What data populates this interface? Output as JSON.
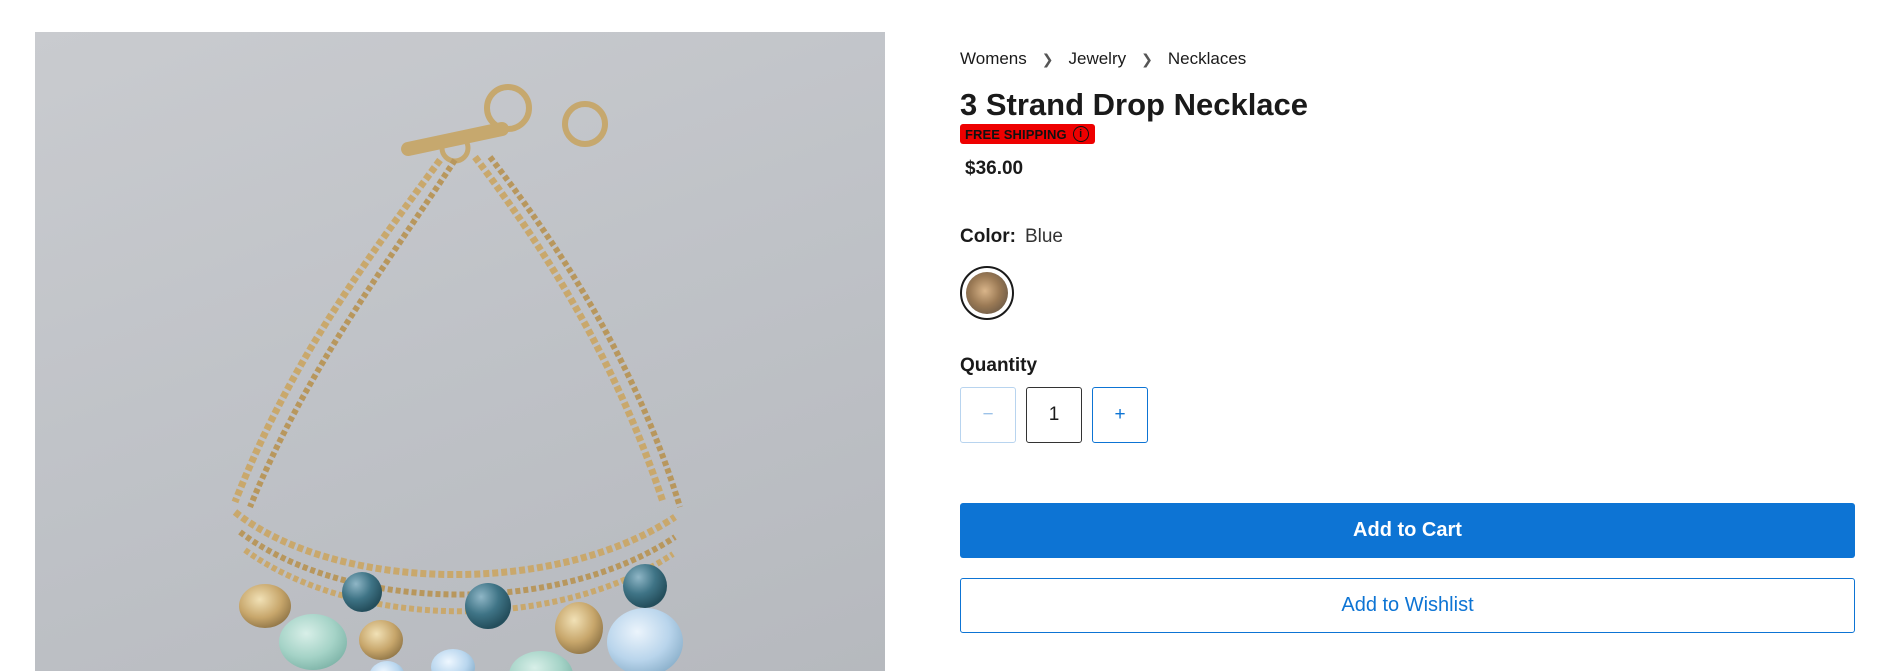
{
  "product_image": {
    "alt": "3 Strand Drop Necklace"
  },
  "breadcrumb": [
    "Womens",
    "Jewelry",
    "Necklaces"
  ],
  "product": {
    "title": "3 Strand Drop Necklace",
    "badge_label": "FREE SHIPPING",
    "badge_icon": "i",
    "price": "$36.00"
  },
  "color": {
    "label": "Color:",
    "selected": "Blue"
  },
  "quantity": {
    "label": "Quantity",
    "minus_symbol": "−",
    "plus_symbol": "+",
    "value": "1"
  },
  "actions": {
    "add_to_cart": "Add to Cart",
    "add_to_wishlist": "Add to Wishlist"
  },
  "colors": {
    "primary": "#0d74d4",
    "badge": "#ee0000"
  }
}
